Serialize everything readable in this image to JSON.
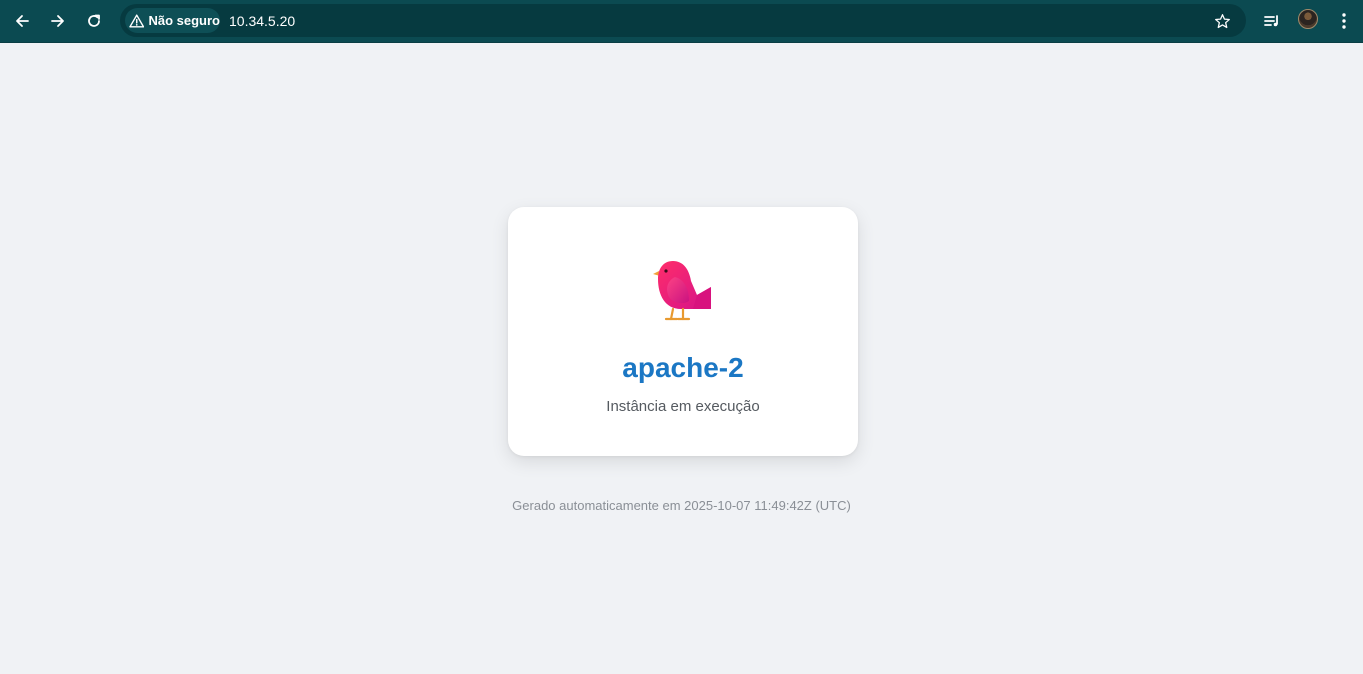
{
  "browser": {
    "security_label": "Não seguro",
    "url": "10.34.5.20",
    "icons": [
      "back-arrow-icon",
      "forward-arrow-icon",
      "reload-icon",
      "warning-icon",
      "star-icon",
      "media-controls-icon",
      "avatar",
      "more-vert-icon"
    ],
    "colors": {
      "toolbar": "#0b4a51",
      "omnibox": "#063a40"
    }
  },
  "page": {
    "title": "apache-2",
    "subtitle": "Instância em execução",
    "footer": "Gerado automaticamente em 2025-10-07 11:49:42Z (UTC)",
    "colors": {
      "title": "#1b77c4",
      "background": "#f0f2f5"
    }
  }
}
